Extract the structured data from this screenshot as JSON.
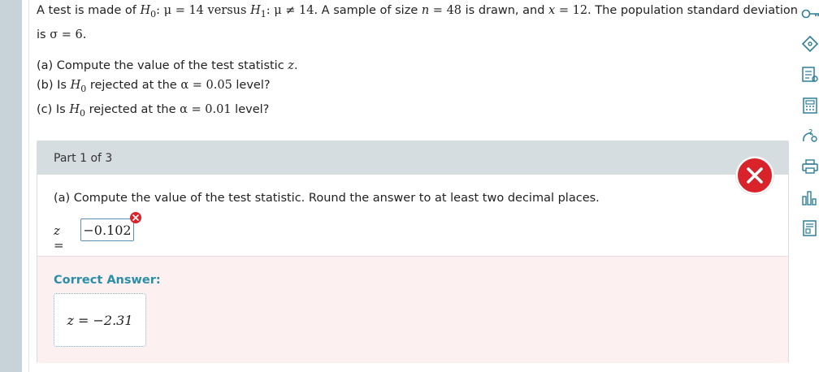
{
  "question": {
    "line1": {
      "t1": "A test is made of ",
      "h0": "H",
      "h0_sub": "0",
      "c1": ": μ = 14 versus ",
      "h1": "H",
      "h1_sub": "1",
      "c2": ": μ ≠ 14.",
      "t2": " A sample of size ",
      "n_var": "n",
      "n_eq": " = 48",
      "t3": " is drawn, and ",
      "x_var": "x",
      "x_eq": " = 12.",
      "t4": " The population standard deviation"
    },
    "line2": {
      "t1": "is ",
      "sigma": "σ = 6."
    },
    "a": {
      "text": "(a) Compute the value of the test statistic ",
      "var": "z",
      "end": "."
    },
    "b": {
      "text": "(b) Is ",
      "h": "H",
      "sub": "0",
      "mid": " rejected at the ",
      "alpha": "α = 0.05",
      "end": " level?"
    },
    "c": {
      "text": "(c) Is ",
      "h": "H",
      "sub": "0",
      "mid": " rejected at the ",
      "alpha": "α = 0.01",
      "end": " level?"
    }
  },
  "part": {
    "title": "Part 1 of 3",
    "prompt": "(a) Compute the value of the test statistic. Round the answer to at least two decimal places.",
    "answer_label": "z =",
    "answer_value": "−0.102",
    "status": "incorrect"
  },
  "correct": {
    "title": "Correct Answer:",
    "value": "z = −2.31"
  },
  "sidebar_icons": [
    "key-icon",
    "tag-icon",
    "notes-icon",
    "calculator-icon",
    "help-icon",
    "print-icon",
    "chart-icon",
    "data-icon"
  ],
  "colors": {
    "accent": "#2a8eab",
    "error": "#d8232a",
    "header_bg": "#d6dde1",
    "correct_bg": "#fdf0f0"
  }
}
